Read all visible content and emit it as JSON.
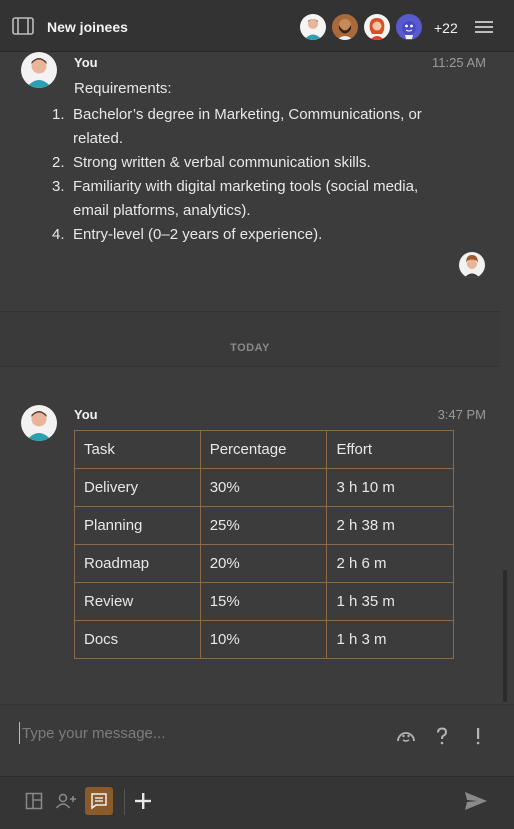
{
  "header": {
    "title": "New joinees",
    "more_members": "+22",
    "panel_icon": "panel-toggle-icon",
    "menu_icon": "hamburger-menu-icon"
  },
  "messages": [
    {
      "sender": "You",
      "time": "11:25 AM",
      "intro": "Requirements:",
      "items": [
        {
          "num": "1.",
          "text": "Bachelor’s degree in Marketing, Communications, or related."
        },
        {
          "num": "2.",
          "text": "Strong written & verbal communication skills."
        },
        {
          "num": "3.",
          "text": "Familiarity with digital marketing tools (social media, email platforms, analytics)."
        },
        {
          "num": "4.",
          "text": "Entry-level (0–2 years of experience)."
        }
      ]
    },
    {
      "sender": "You",
      "time": "3:47 PM",
      "table": {
        "headers": [
          "Task",
          "Percentage",
          "Effort"
        ],
        "rows": [
          [
            "Delivery",
            "30%",
            "3 h 10 m"
          ],
          [
            "Planning",
            "25%",
            "2 h 38 m"
          ],
          [
            "Roadmap",
            "20%",
            "2 h 6 m"
          ],
          [
            "Review",
            "15%",
            "1 h 35 m"
          ],
          [
            "Docs",
            "10%",
            "1 h 3 m"
          ]
        ]
      }
    }
  ],
  "divider": {
    "label": "TODAY"
  },
  "composer": {
    "placeholder": "Type your message...",
    "value": ""
  },
  "colors": {
    "accent": "#8a5a2a",
    "table_border": "#8a6a4a",
    "background": "#3c3c3c"
  }
}
